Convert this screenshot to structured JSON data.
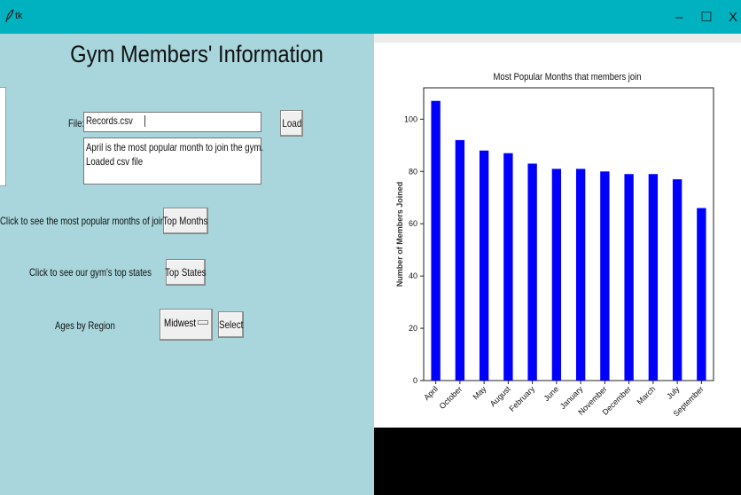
{
  "window": {
    "title": "tk",
    "minimize_glyph": "–",
    "maximize_glyph": "☐",
    "close_glyph": "X",
    "icon": "feather-icon",
    "titlebar_color": "#00b2bf"
  },
  "left_panel": {
    "background": "#a8d6dc",
    "title": "Gym Members' Information",
    "file_label": "File:",
    "file_value": "Records.csv",
    "load_button": "Load",
    "output_lines": [
      "April is the most popular month to join the gym.",
      "Loaded csv file"
    ],
    "months_prompt": "Click to see the most popular months of joining",
    "months_button": "Top Months",
    "states_prompt": "Click to see our gym's top states",
    "states_button": "Top States",
    "region_prompt": "Ages by Region",
    "region_selected": "Midwest",
    "select_button": "Select"
  },
  "chart_data": {
    "type": "bar",
    "title": "Most Popular Months that members join",
    "xlabel": "",
    "ylabel": "Number of Members Joined",
    "categories": [
      "April",
      "October",
      "May",
      "August",
      "February",
      "June",
      "January",
      "November",
      "December",
      "March",
      "July",
      "September"
    ],
    "values": [
      107,
      92,
      88,
      87,
      83,
      81,
      81,
      80,
      79,
      79,
      77,
      66
    ],
    "ylim": [
      0,
      112
    ],
    "yticks": [
      0,
      20,
      40,
      60,
      80,
      100
    ],
    "bar_color": "#0000ff",
    "grid": false
  }
}
